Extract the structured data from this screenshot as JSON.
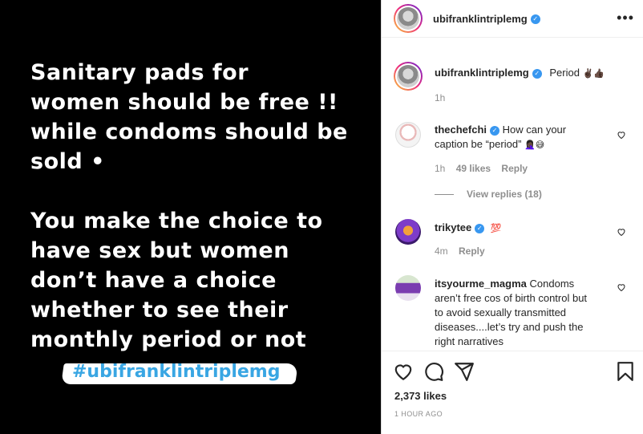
{
  "post_image": {
    "paragraphs": [
      "Sanitary pads for\nwomen should be free !!\nwhile condoms should be\nsold •",
      "You make the choice to\nhave sex but women\ndon’t have a choice\nwhether to see their\nmonthly period or not"
    ],
    "hashtag": "#ubifranklintriplemg"
  },
  "header": {
    "username": "ubifranklintriplemg",
    "more_icon": "more-horizontal-icon"
  },
  "caption": {
    "username": "ubifranklintriplemg",
    "text": "Period",
    "emojis": "✌🏿👍🏿",
    "time": "1h"
  },
  "comments": [
    {
      "username": "thechefchi",
      "text": "How can your caption be “period”",
      "emojis": "🤦🏿‍♀️😅",
      "time": "1h",
      "likes": "49 likes",
      "reply": "Reply"
    },
    {
      "username": "trikytee",
      "text": "",
      "emojis": "💯",
      "time": "4m",
      "likes": "",
      "reply": "Reply"
    },
    {
      "username": "itsyourme_magma",
      "text": "Condoms aren’t free cos of birth control but to avoid sexually transmitted diseases....let’s try and push the right narratives",
      "emojis": "",
      "time": "",
      "likes": "",
      "reply": ""
    }
  ],
  "view_replies": "View replies (18)",
  "footer": {
    "likes": "2,373 likes",
    "time": "1 HOUR AGO"
  },
  "colors": {
    "verified": "#3897f0",
    "hashtag": "#39a6e3",
    "muted": "#8e8e8e"
  }
}
